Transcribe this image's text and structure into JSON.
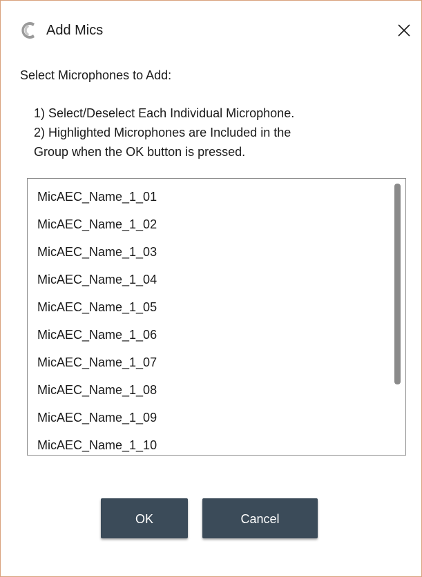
{
  "window": {
    "title": "Add Mics",
    "app_icon": "brand-c-logo-icon",
    "close_icon": "close-icon"
  },
  "prompt": "Select Microphones to Add:",
  "instructions": [
    "1) Select/Deselect Each Individual Microphone.",
    "2) Highlighted Microphones are Included in the",
    "Group when the OK button is pressed."
  ],
  "microphones": [
    "MicAEC_Name_1_01",
    "MicAEC_Name_1_02",
    "MicAEC_Name_1_03",
    "MicAEC_Name_1_04",
    "MicAEC_Name_1_05",
    "MicAEC_Name_1_06",
    "MicAEC_Name_1_07",
    "MicAEC_Name_1_08",
    "MicAEC_Name_1_09",
    "MicAEC_Name_1_10"
  ],
  "buttons": {
    "ok": "OK",
    "cancel": "Cancel"
  },
  "colors": {
    "button_bg": "#3b4b59",
    "button_text": "#ffffff",
    "window_border": "#d9a27d"
  }
}
